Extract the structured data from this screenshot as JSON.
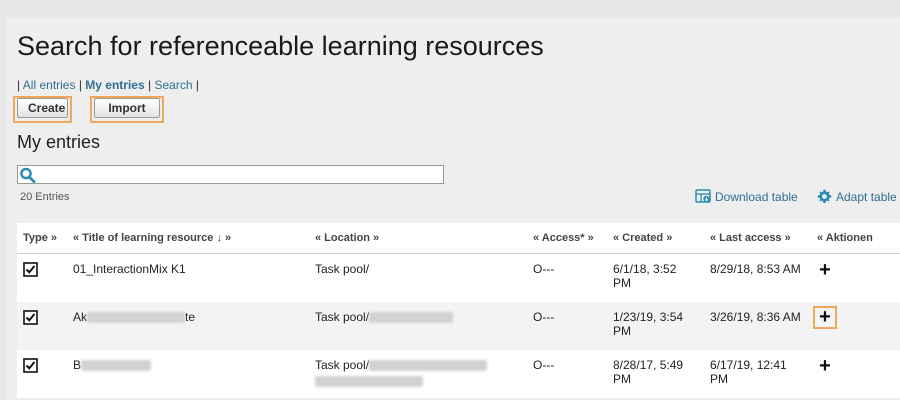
{
  "page": {
    "title": "Search for referenceable learning resources",
    "subnav": {
      "sep": "|",
      "all": "All entries",
      "mine": "My entries",
      "search": "Search"
    },
    "create_label": "Create",
    "import_label": "Import",
    "section_title": "My entries",
    "search_placeholder": "",
    "entries_count": "20 Entries",
    "download_label": "Download table",
    "adapt_label": "Adapt table"
  },
  "table": {
    "headers": {
      "type": "Type »",
      "title": "« Title of learning resource ↓ »",
      "location": "« Location »",
      "access": "« Access* »",
      "created": "« Created »",
      "last_access": "« Last access »",
      "actions": "« Aktionen"
    },
    "rows": [
      {
        "title": "01_InteractionMix K1",
        "location": "Task pool/",
        "access": "O---",
        "created_1": "6/1/18, 3:52",
        "created_2": "PM",
        "last_access": "8/29/18, 8:53 AM"
      },
      {
        "title_pre": "Ak",
        "title_post": "te",
        "location": "Task pool/",
        "access": "O---",
        "created_1": "1/23/19, 3:54",
        "created_2": "PM",
        "last_access": "3/26/19, 8:36 AM"
      },
      {
        "title_pre": "B",
        "location": "Task pool/",
        "access": "O---",
        "created_1": "8/28/17, 5:49",
        "created_2": "PM",
        "last_access_1": "6/17/19, 12:41",
        "last_access_2": "PM"
      }
    ]
  },
  "colors": {
    "link": "#2f6f8f",
    "access": "#d9541e",
    "highlight": "#f0a85a"
  }
}
